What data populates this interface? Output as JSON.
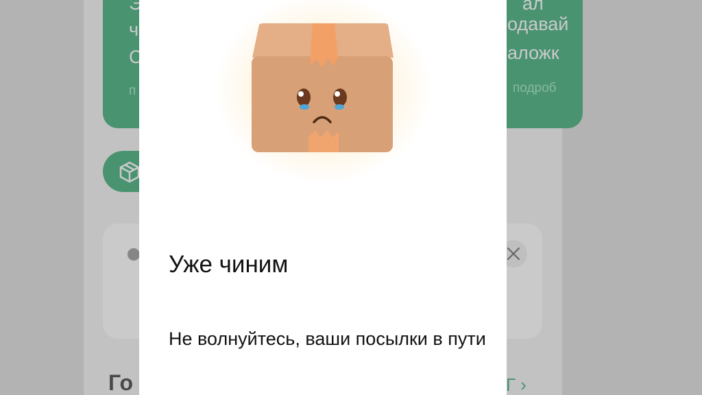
{
  "modal": {
    "title": "Уже чиним",
    "message": "Не волнуйтесь, ваши посылки в пути",
    "illustration": "sad-parcel-box"
  },
  "background": {
    "promo": {
      "line1_left": "Э",
      "line1_right": "ал",
      "line2_left": "ч",
      "line2_right": "одавай",
      "line3_left": "С",
      "line3_right": "аложк",
      "link_left": "п",
      "link_right": "подроб"
    },
    "track_pill_icon": "parcel-box-icon",
    "notice_close_icon": "close-icon",
    "section_title": "Го",
    "all_link": "Г ›"
  },
  "colors": {
    "brand_green": "#21a165",
    "box_body": "#d7a077",
    "box_tape": "#f2a065",
    "dim_overlay": "rgba(128,128,128,0.42)"
  }
}
